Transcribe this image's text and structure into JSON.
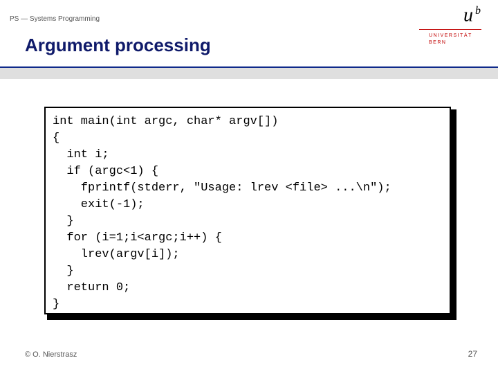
{
  "header": {
    "course": "PS — Systems Programming"
  },
  "title": "Argument processing",
  "logo": {
    "mark": "u",
    "sup": "b",
    "line1": "UNIVERSITÄT",
    "line2": "BERN"
  },
  "code": "int main(int argc, char* argv[])\n{\n  int i;\n  if (argc<1) {\n    fprintf(stderr, \"Usage: lrev <file> ...\\n\");\n    exit(-1);\n  }\n  for (i=1;i<argc;i++) {\n    lrev(argv[i]);\n  }\n  return 0;\n}",
  "footer": {
    "copyright": "© O. Nierstrasz",
    "page": "27"
  }
}
